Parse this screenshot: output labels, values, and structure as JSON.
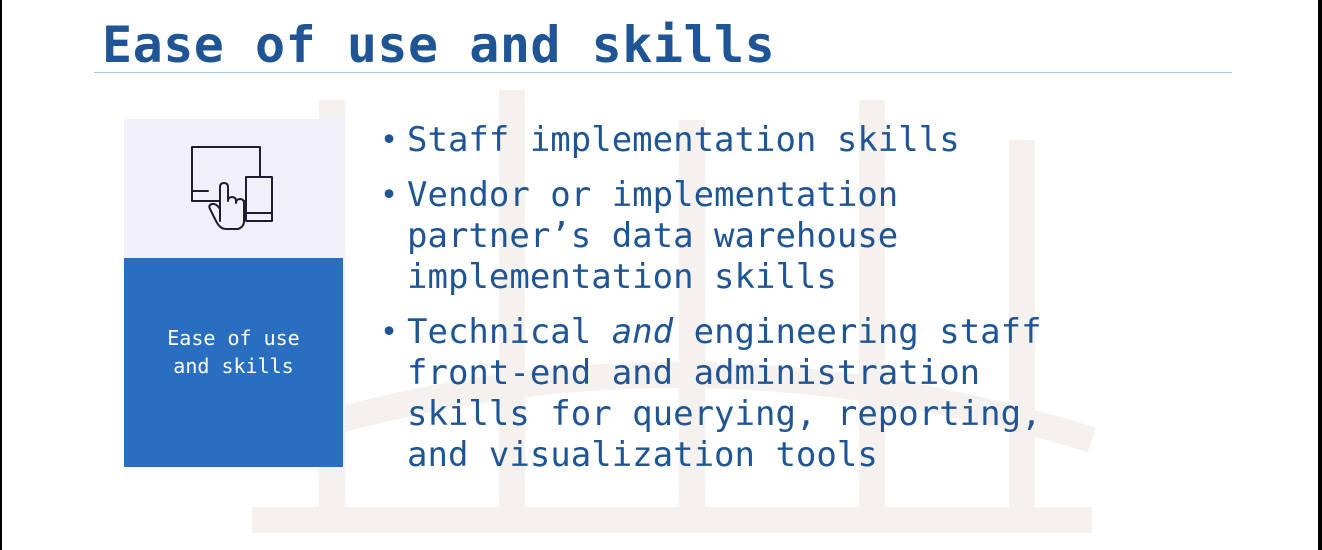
{
  "slide": {
    "title": "Ease of use and skills",
    "colors": {
      "title": "#1f5594",
      "rule": "#a9cbd9",
      "card_top": "#f1f0f8",
      "card_bottom": "#2a6ebf",
      "card_text": "#ffffff",
      "bullet_text": "#1f5594"
    }
  },
  "card": {
    "icon": "touchscreen-devices-icon",
    "label_line1": "Ease of use",
    "label_line2": "and skills"
  },
  "bullets": [
    {
      "marker": "•",
      "lines": [
        "Staff implementation skills"
      ]
    },
    {
      "marker": "•",
      "lines": [
        "Vendor or implementation",
        "partner’s data warehouse",
        "implementation skills"
      ]
    },
    {
      "marker": "•",
      "line1_pre": "Technical ",
      "line1_em": "and",
      "line1_post": " engineering staff",
      "lines": [
        "front-end and administration",
        "skills for querying, reporting,",
        "and visualization tools"
      ]
    }
  ]
}
